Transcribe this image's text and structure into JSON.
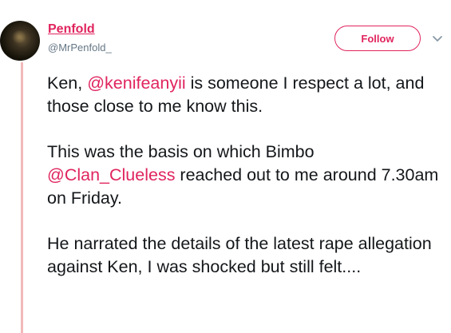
{
  "author": {
    "display_name": "Penfold",
    "handle": "@MrPenfold_"
  },
  "actions": {
    "follow_label": "Follow",
    "menu_icon": "chevron-down-icon"
  },
  "tweet": {
    "p1_before": "Ken, ",
    "p1_mention": "@kenifeanyii",
    "p1_after": " is someone I respect a lot, and those close to me know this.",
    "p2_before": "This was the basis on which Bimbo ",
    "p2_mention": "@Clan_Clueless",
    "p2_after": " reached out to me around 7.30am on Friday.",
    "p3": "He narrated the details of the latest rape allegation against Ken, I was shocked but still felt...."
  },
  "colors": {
    "accent": "#e0245e",
    "thread_line": "#f2b9b9",
    "text": "#14171a",
    "muted": "#657786"
  }
}
